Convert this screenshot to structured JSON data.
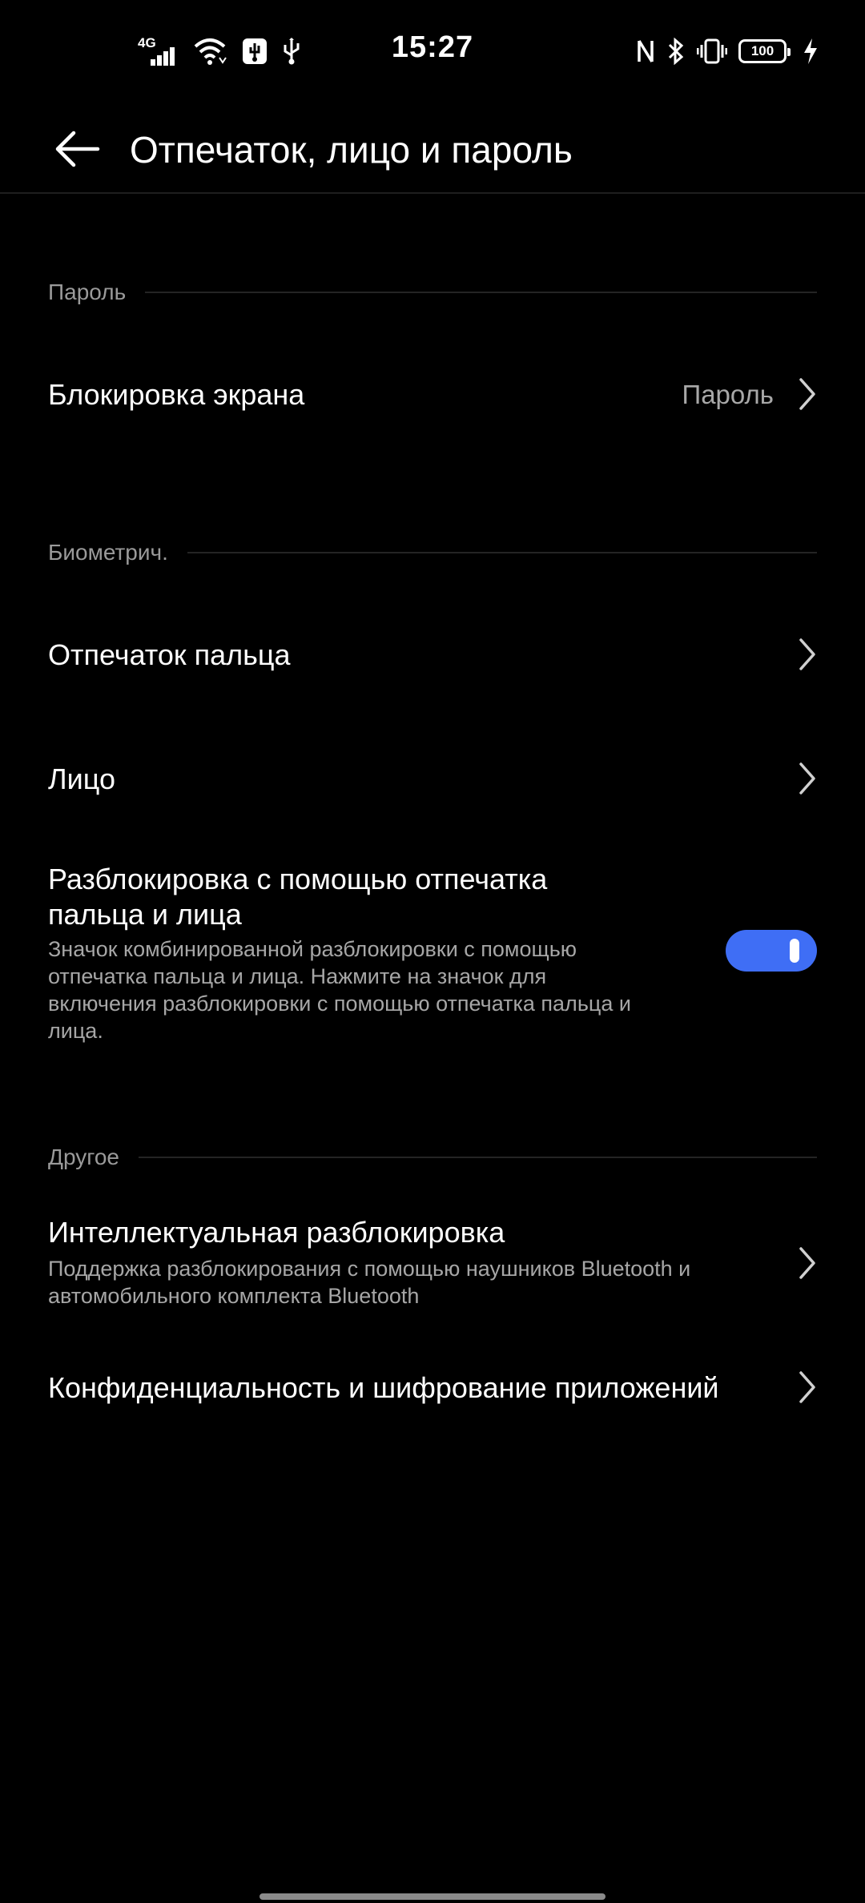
{
  "status_bar": {
    "network_label": "4G",
    "time": "15:27",
    "battery_level": "100"
  },
  "app_bar": {
    "title": "Отпечаток, лицо и пароль"
  },
  "sections": {
    "password": {
      "header": "Пароль",
      "screen_lock": {
        "title": "Блокировка экрана",
        "value": "Пароль"
      }
    },
    "biometrics": {
      "header": "Биометрич.",
      "fingerprint": {
        "title": "Отпечаток пальца"
      },
      "face": {
        "title": "Лицо"
      },
      "combined_unlock": {
        "title_line1": "Разблокировка с помощью отпечатка",
        "title_line2": "пальца и лица",
        "desc_line1": "Значок комбинированной разблокировки с помощью",
        "desc_line2": "отпечатка пальца и лица. Нажмите на значок для",
        "desc_line3": "включения разблокировки с помощью отпечатка пальца и",
        "desc_line4": "лица.",
        "enabled": true
      }
    },
    "other": {
      "header": "Другое",
      "smart_unlock": {
        "title": "Интеллектуальная разблокировка",
        "desc_line1": "Поддержка разблокирования с помощью наушников Bluetooth и",
        "desc_line2": "автомобильного комплекта Bluetooth"
      },
      "app_privacy": {
        "title": "Конфиденциальность и шифрование приложений"
      }
    }
  },
  "colors": {
    "background": "#000000",
    "accent": "#3f6ef5",
    "secondary_text": "#a6a6a6"
  }
}
